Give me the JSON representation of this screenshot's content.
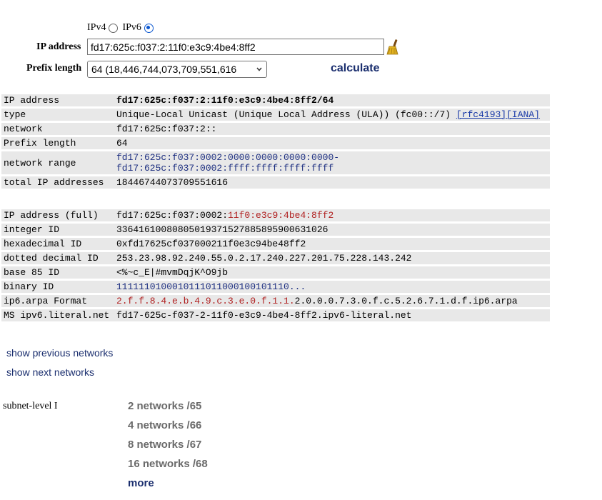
{
  "form": {
    "ipv4_label": "IPv4",
    "ipv6_label": "IPv6",
    "selected_version": "IPv6",
    "ip_label": "IP address",
    "ip_value": "fd17:625c:f037:2:11f0:e3c9:4be4:8ff2",
    "prefix_label": "Prefix length",
    "prefix_selected": "64 (18,446,744,073,709,551,616",
    "calculate_label": "calculate"
  },
  "info": {
    "rows": [
      {
        "key": "IP address",
        "value": "fd17:625c:f037:2:11f0:e3c9:4be4:8ff2/64"
      },
      {
        "key": "type",
        "value": "Unique-Local Unicast (Unique Local Address (ULA)) (fc00::/7)",
        "link1": "[rfc4193]",
        "link2": "[IANA]"
      },
      {
        "key": "network",
        "value": "fd17:625c:f037:2::"
      },
      {
        "key": "Prefix length",
        "value": "64"
      },
      {
        "key": "network range",
        "value": "fd17:625c:f037:0002:0000:0000:0000:0000-",
        "value2": "fd17:625c:f037:0002:ffff:ffff:ffff:ffff"
      },
      {
        "key": "total IP addresses",
        "value": "18446744073709551616"
      }
    ]
  },
  "ids": {
    "rows": [
      {
        "key": "IP address (full)",
        "value_net": "fd17:625c:f037:0002:",
        "value_host": "11f0:e3c9:4be4:8ff2"
      },
      {
        "key": "integer ID",
        "value": "336416100808050193715278858959006310 26"
      },
      {
        "key": "hexadecimal ID",
        "value": "0xfd17625cf037000211f0e3c94be48ff2"
      },
      {
        "key": "dotted decimal ID",
        "value": "253.23.98.92.240.55.0.2.17.240.227.201.75.228.143.242"
      },
      {
        "key": "base 85 ID",
        "value": "<%~c_E|#mvmDqjK^O9jb"
      },
      {
        "key": "binary ID",
        "value": "1111110100010111011000100101110..."
      },
      {
        "key": "ip6.arpa Format",
        "value_host": "2.f.f.8.4.e.b.4.9.c.3.e.0.f.1.1.",
        "value_net": "2.0.0.0.7.3.0.f.c.5.2.6.7.1.d.f.ip6.arpa"
      },
      {
        "key": "MS ipv6.literal.net",
        "value": "fd17-625c-f037-2-11f0-e3c9-4be4-8ff2.ipv6-literal.net"
      }
    ]
  },
  "nav": {
    "previous": "show previous networks",
    "next": "show next networks"
  },
  "subnets": {
    "label": "subnet-level I",
    "items": [
      "2 networks /65",
      "4 networks /66",
      "8 networks /67",
      "16 networks /68"
    ],
    "more": "more"
  }
}
